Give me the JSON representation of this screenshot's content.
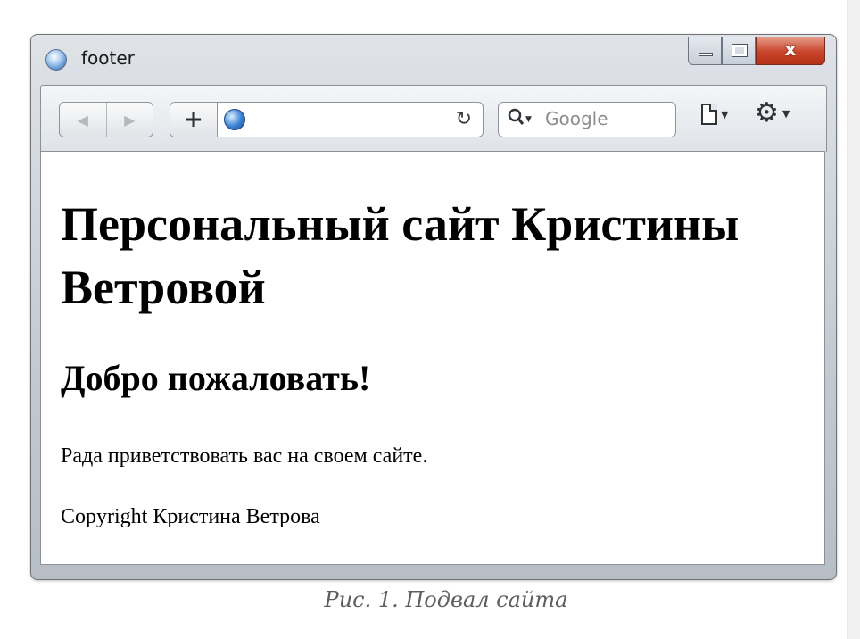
{
  "window": {
    "title": "footer"
  },
  "window_controls": {
    "close_label": "x"
  },
  "toolbar": {
    "back_glyph": "◀",
    "forward_glyph": "▶",
    "add_glyph": "+",
    "reload_glyph": "↻",
    "search_icon_glyph": "🔍",
    "search_placeholder": "Google",
    "gear_glyph": "⚙"
  },
  "content": {
    "heading": "Персональный сайт Кристины Ветровой",
    "subheading": "Добро пожаловать!",
    "paragraph": "Рада приветствовать вас на своем сайте.",
    "footer": "Copyright Кристина Ветрова"
  },
  "caption": "Рис. 1. Подвал сайта"
}
